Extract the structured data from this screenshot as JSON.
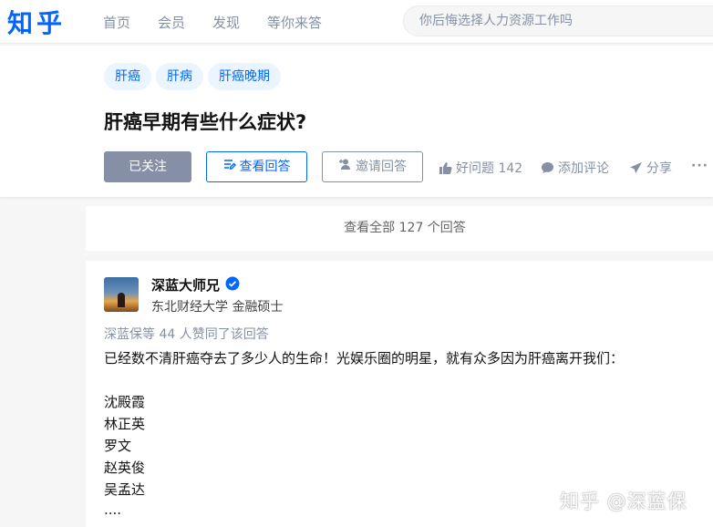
{
  "header": {
    "logo": "知乎",
    "nav": [
      "首页",
      "会员",
      "发现",
      "等你来答"
    ],
    "search_placeholder": "你后悔选择人力资源工作吗"
  },
  "question": {
    "tags": [
      "肝癌",
      "肝病",
      "肝癌晚期"
    ],
    "title": "肝癌早期有些什么症状?",
    "follow_label": "已关注",
    "view_answers_label": "查看回答",
    "invite_label": "邀请回答",
    "good_question_label": "好问题 142",
    "comment_label": "添加评论",
    "share_label": "分享",
    "more_label": "···"
  },
  "view_all": "查看全部 127 个回答",
  "answer": {
    "author": "深蓝大师兄",
    "headline": "东北财经大学 金融硕士",
    "voters": "深蓝保等 44 人赞同了该回答",
    "paragraphs": [
      "已经数不清肝癌夺去了多少人的生命！光娱乐圈的明星，就有众多因为肝癌离开我们：",
      "沈殿霞",
      "林正英",
      "罗文",
      "赵英俊",
      "吴孟达",
      "...."
    ]
  },
  "watermark": "知乎 @深蓝保",
  "colors": {
    "brand_blue": "#0066ff",
    "muted": "#8590a6",
    "tag_bg": "#ebf5ff"
  }
}
